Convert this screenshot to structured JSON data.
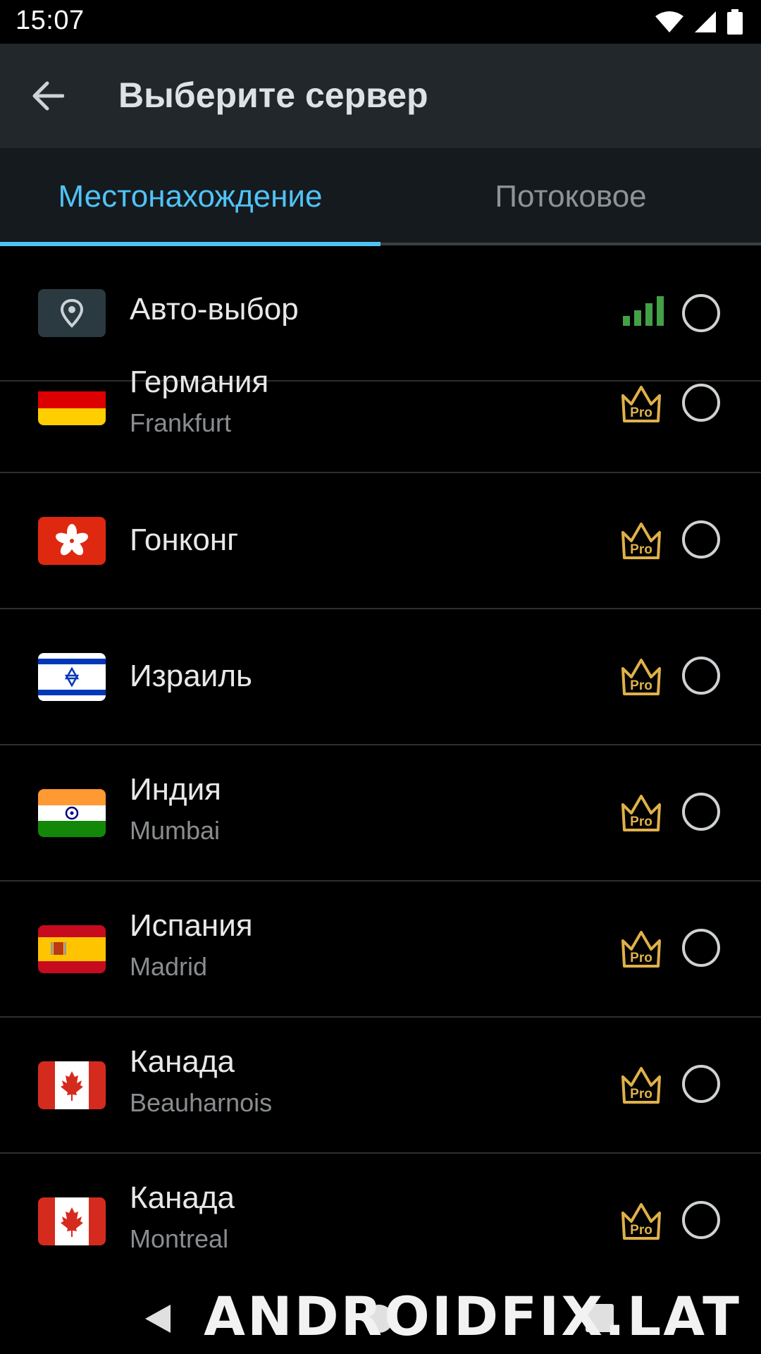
{
  "status_bar": {
    "time": "15:07",
    "icons": [
      "wifi-icon",
      "cell-signal-icon",
      "battery-icon"
    ]
  },
  "app_bar": {
    "back_icon": "arrow-back-icon",
    "title": "Выберите сервер"
  },
  "tabs": [
    {
      "label": "Местонахождение",
      "active": true
    },
    {
      "label": "Потоковое",
      "active": false
    }
  ],
  "colors": {
    "accent": "#4fc3f7",
    "pro_gold": "#e0b04a",
    "signal_green": "#43a047",
    "background": "#000000",
    "app_bar": "#22272b"
  },
  "servers": [
    {
      "name": "Авто-выбор",
      "city": "",
      "flag": "location-pin-icon",
      "badge": "signal-strength-icon",
      "selected": false
    },
    {
      "name": "Германия",
      "city": "Frankfurt",
      "flag": "germany-flag",
      "badge": "Pro",
      "selected": false
    },
    {
      "name": "Гонконг",
      "city": "",
      "flag": "hong-kong-flag",
      "badge": "Pro",
      "selected": false
    },
    {
      "name": "Израиль",
      "city": "",
      "flag": "israel-flag",
      "badge": "Pro",
      "selected": false
    },
    {
      "name": "Индия",
      "city": "Mumbai",
      "flag": "india-flag",
      "badge": "Pro",
      "selected": false
    },
    {
      "name": "Испания",
      "city": "Madrid",
      "flag": "spain-flag",
      "badge": "Pro",
      "selected": false
    },
    {
      "name": "Канада",
      "city": "Beauharnois",
      "flag": "canada-flag",
      "badge": "Pro",
      "selected": false
    },
    {
      "name": "Канада",
      "city": "Montreal",
      "flag": "canada-flag",
      "badge": "Pro",
      "selected": false
    }
  ],
  "nav_bar": {
    "buttons": [
      "nav-back-icon",
      "nav-home-icon",
      "nav-recents-icon"
    ]
  },
  "watermark": "ANDROIDFIX.LAT"
}
